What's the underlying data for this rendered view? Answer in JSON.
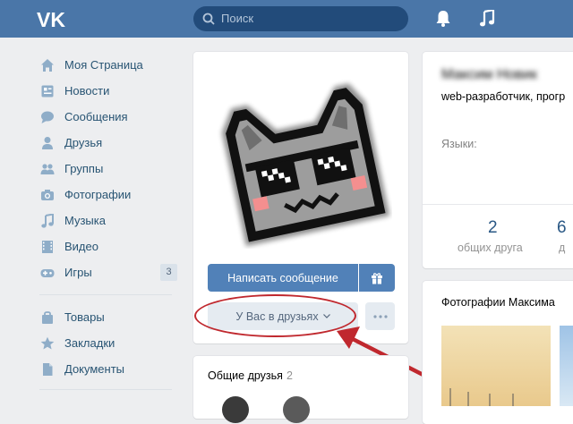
{
  "header": {
    "logo": "VK",
    "search_placeholder": "Поиск",
    "icons": [
      "bell-icon",
      "music-note-icon"
    ]
  },
  "sidebar": {
    "items": [
      {
        "label": "Моя Страница",
        "icon": "home-icon"
      },
      {
        "label": "Новости",
        "icon": "news-icon"
      },
      {
        "label": "Сообщения",
        "icon": "chat-icon"
      },
      {
        "label": "Друзья",
        "icon": "person-icon"
      },
      {
        "label": "Группы",
        "icon": "group-icon"
      },
      {
        "label": "Фотографии",
        "icon": "camera-icon"
      },
      {
        "label": "Музыка",
        "icon": "music-icon"
      },
      {
        "label": "Видео",
        "icon": "film-icon"
      },
      {
        "label": "Игры",
        "icon": "gamepad-icon",
        "count": "3"
      },
      {
        "label": "Товары",
        "icon": "bag-icon"
      },
      {
        "label": "Закладки",
        "icon": "star-icon"
      },
      {
        "label": "Документы",
        "icon": "document-icon"
      }
    ]
  },
  "profile": {
    "name": "Максим Новик",
    "status": "web-разработчик, прогр",
    "languages_label": "Языки:",
    "write_message": "Написать сообщение",
    "friend_status": "У Вас в друзьях",
    "mutual_friends_title": "Общие друзья",
    "mutual_friends_count": "2",
    "counters": [
      {
        "value": "2",
        "label": "общих друга"
      },
      {
        "value": "6",
        "label": "д"
      }
    ],
    "photos_title": "Фотографии Максима"
  },
  "colors": {
    "header": "#4a76a8",
    "button": "#5181b8",
    "annotation": "#c0282e"
  }
}
